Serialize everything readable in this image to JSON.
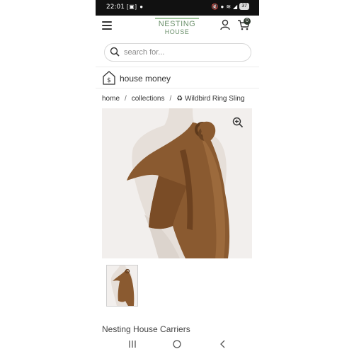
{
  "status_bar": {
    "time": "22:01",
    "left_icons": "[▣] ●",
    "battery": "37"
  },
  "header": {
    "logo_line1": "NESTING",
    "logo_line2": "HOUSE",
    "cart_count": "0"
  },
  "search": {
    "placeholder": "search for..."
  },
  "house_money": {
    "label": "house money"
  },
  "breadcrumb": {
    "home": "home",
    "sep1": "/",
    "collections": "collections",
    "sep2": "/",
    "current": "♻ Wildbird Ring Sling"
  },
  "product": {
    "brand": "Nesting House Carriers"
  },
  "icons": {
    "menu": "hamburger-icon",
    "account": "user-icon",
    "cart": "cart-icon",
    "search": "search-icon",
    "house_money": "house-dollar-icon",
    "zoom": "zoom-in-icon",
    "nav_recent": "recent-apps-icon",
    "nav_home": "home-circle-icon",
    "nav_back": "back-chevron-icon"
  },
  "colors": {
    "brand_green": "#6a8f6a",
    "status_bar": "#111111",
    "sling_brown": "#8a5a30"
  }
}
